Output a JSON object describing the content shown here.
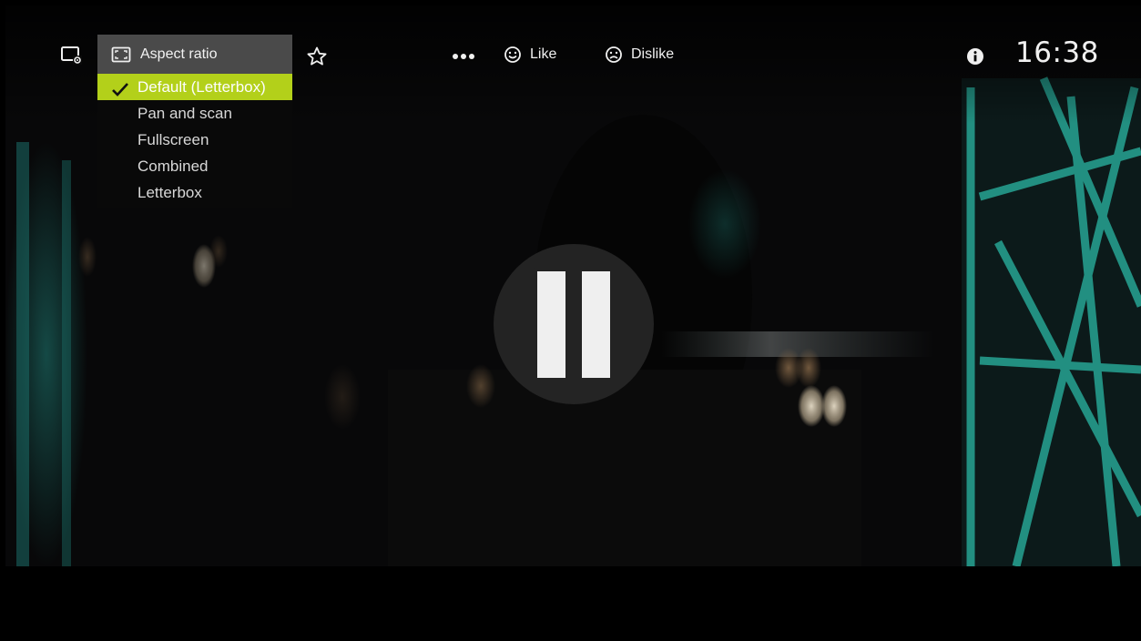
{
  "player": {
    "topbar": {
      "screen_settings_icon": "screen-settings-icon",
      "star_icon": "star-outline-icon",
      "more_icon": "more-dots-icon",
      "like_label": "Like",
      "like_icon": "smile-face-icon",
      "dislike_label": "Dislike",
      "dislike_icon": "sad-face-icon",
      "info_icon": "info-icon",
      "clock": "16:38"
    },
    "aspect_menu": {
      "title": "Aspect ratio",
      "title_icon": "aspect-ratio-icon",
      "options": [
        {
          "label": "Default (Letterbox)",
          "selected": true
        },
        {
          "label": "Pan and scan",
          "selected": false
        },
        {
          "label": "Fullscreen",
          "selected": false
        },
        {
          "label": "Combined",
          "selected": false
        },
        {
          "label": "Letterbox",
          "selected": false
        }
      ],
      "selected_color": "#b3d01a"
    },
    "playback": {
      "state_icon": "pause-icon"
    }
  }
}
